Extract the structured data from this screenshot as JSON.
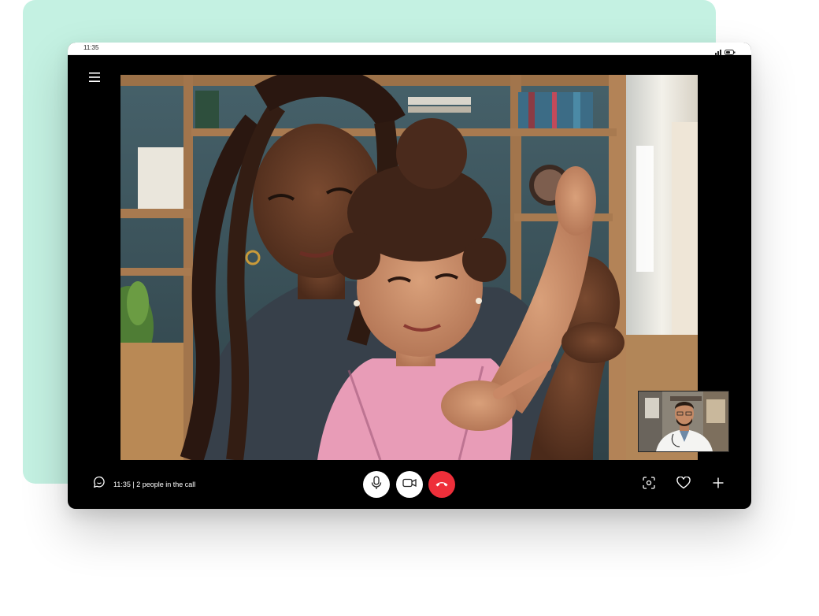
{
  "status_bar": {
    "time": "11:35"
  },
  "call": {
    "info": "11:35 | 2 people in the call"
  },
  "icons": {
    "menu": "hamburger-menu-icon",
    "chat": "chat-bubble-icon",
    "mic": "microphone-icon",
    "camera": "video-camera-icon",
    "end_call": "phone-hangup-icon",
    "capture": "screenshot-capture-icon",
    "react": "heart-icon",
    "add": "plus-icon",
    "signal": "signal-bars-icon",
    "battery": "battery-icon"
  },
  "colors": {
    "mint_background": "#c4f1e2",
    "end_call_red": "#ee2f3a",
    "tablet_frame": "#000000",
    "control_white": "#ffffff"
  }
}
